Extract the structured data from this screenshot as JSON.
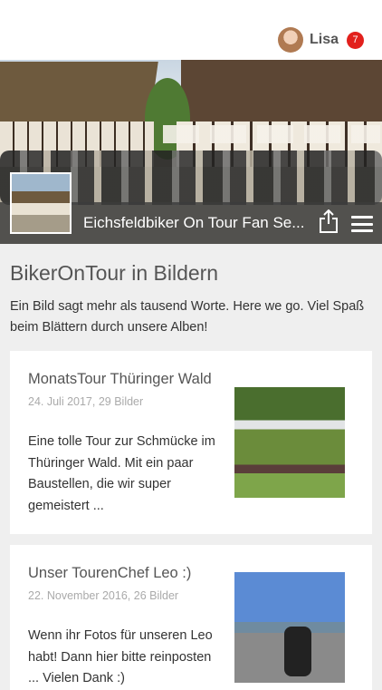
{
  "user": {
    "name": "Lisa",
    "notifications": "7"
  },
  "header": {
    "title": "Eichsfeldbiker On Tour Fan Se..."
  },
  "section": {
    "title": "BikerOnTour in Bildern",
    "intro": "Ein Bild sagt mehr als tausend Worte. Here we go. Viel Spaß beim Blättern durch unsere Alben!"
  },
  "albums": [
    {
      "title": "MonatsTour Thüringer Wald",
      "meta": "24. Juli 2017, 29 Bilder",
      "text": "Eine tolle Tour zur Schmücke im Thüringer Wald. Mit ein paar Baustellen, die wir super gemeistert ..."
    },
    {
      "title": "Unser TourenChef Leo :)",
      "meta": "22. November 2016, 26 Bilder",
      "text": "Wenn ihr Fotos für unseren Leo habt! Dann hier bitte reinposten ... Vielen Dank :)"
    }
  ],
  "colors": {
    "badge": "#e2201c",
    "caption_bar": "#3c3c3c",
    "background": "#efefef"
  },
  "icons": {
    "share": "share-icon",
    "menu": "hamburger-menu-icon"
  }
}
